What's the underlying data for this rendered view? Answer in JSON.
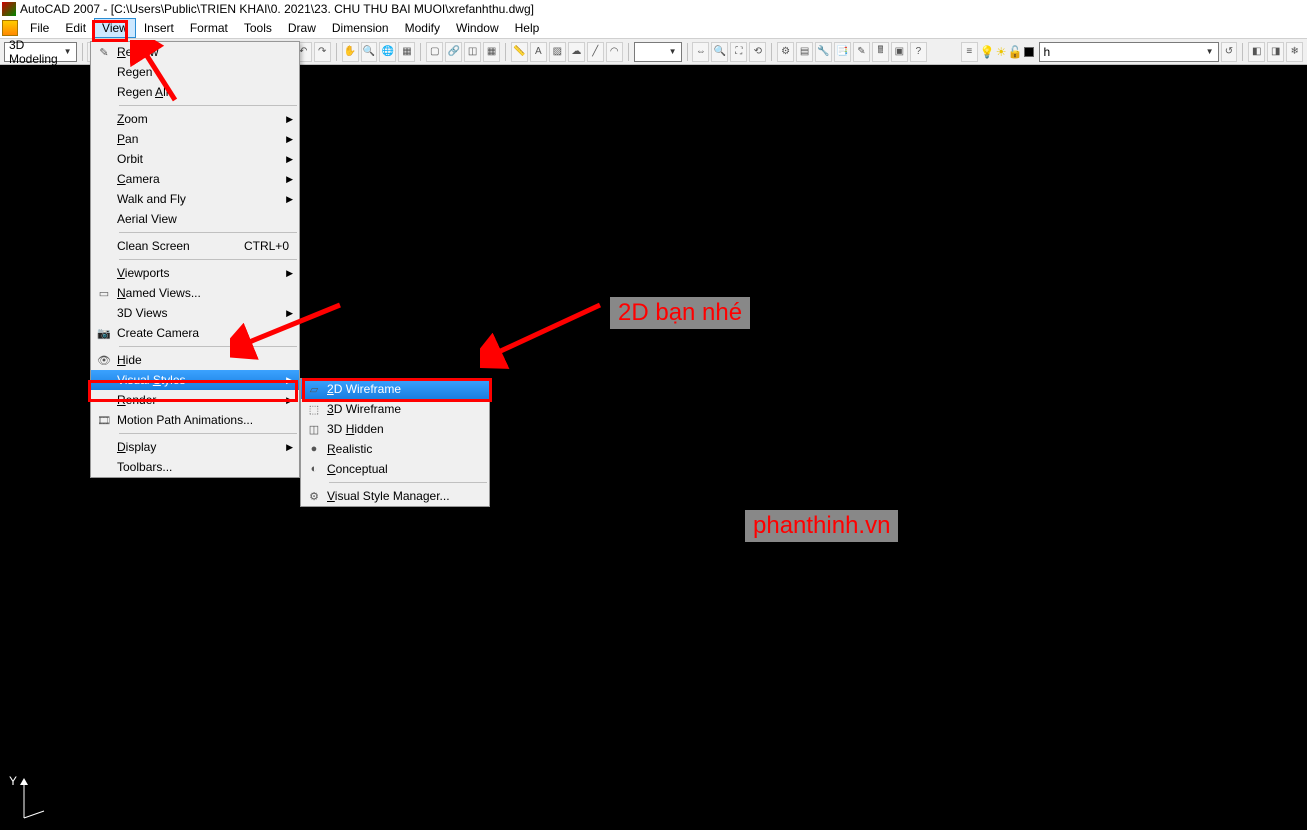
{
  "titlebar": {
    "text": "AutoCAD 2007 - [C:\\Users\\Public\\TRIEN KHAI\\0. 2021\\23. CHU THU BAI MUOI\\xrefanhthu.dwg]"
  },
  "menubar": {
    "items": [
      "File",
      "Edit",
      "View",
      "Insert",
      "Format",
      "Tools",
      "Draw",
      "Dimension",
      "Modify",
      "Window",
      "Help"
    ],
    "active_index": 2
  },
  "toolbar": {
    "workspace_combo": "3D Modeling",
    "layer_combo": "h"
  },
  "view_menu": {
    "groups": [
      [
        {
          "label": "Redraw",
          "u": 0,
          "icon": "pencil",
          "arrow": false
        },
        {
          "label": "Regen",
          "u": 2,
          "arrow": false
        },
        {
          "label": "Regen All",
          "u": 6,
          "arrow": false
        }
      ],
      [
        {
          "label": "Zoom",
          "u": 0,
          "arrow": true
        },
        {
          "label": "Pan",
          "u": 0,
          "arrow": true
        },
        {
          "label": "Orbit",
          "u": -1,
          "arrow": true
        },
        {
          "label": "Camera",
          "u": 0,
          "arrow": true
        },
        {
          "label": "Walk and Fly",
          "u": -1,
          "arrow": true
        },
        {
          "label": "Aerial View",
          "u": -1,
          "arrow": false
        }
      ],
      [
        {
          "label": "Clean Screen",
          "u": -1,
          "accel": "CTRL+0",
          "arrow": false
        }
      ],
      [
        {
          "label": "Viewports",
          "u": 0,
          "arrow": true
        },
        {
          "label": "Named Views...",
          "u": 0,
          "icon": "views",
          "arrow": false
        },
        {
          "label": "3D Views",
          "u": -1,
          "arrow": true
        },
        {
          "label": "Create Camera",
          "u": -1,
          "icon": "camera",
          "arrow": false
        }
      ],
      [
        {
          "label": "Hide",
          "u": 0,
          "icon": "hide",
          "arrow": false
        },
        {
          "label": "Visual Styles",
          "u": 7,
          "arrow": true,
          "highlight": true
        },
        {
          "label": "Render",
          "u": 0,
          "arrow": true
        },
        {
          "label": "Motion Path Animations...",
          "u": -1,
          "icon": "motion",
          "arrow": false
        }
      ],
      [
        {
          "label": "Display",
          "u": 0,
          "arrow": true
        },
        {
          "label": "Toolbars...",
          "u": -1,
          "arrow": false
        }
      ]
    ]
  },
  "visual_styles_submenu": {
    "groups": [
      [
        {
          "label": "2D Wireframe",
          "u": 0,
          "icon": "wire2d",
          "highlight": true
        },
        {
          "label": "3D Wireframe",
          "u": 0,
          "icon": "wire3d"
        },
        {
          "label": "3D Hidden",
          "u": 3,
          "icon": "hidden"
        },
        {
          "label": "Realistic",
          "u": 0,
          "icon": "realistic"
        },
        {
          "label": "Conceptual",
          "u": 0,
          "icon": "conceptual"
        }
      ],
      [
        {
          "label": "Visual Style Manager...",
          "u": 0,
          "icon": "manager"
        }
      ]
    ]
  },
  "annotations": {
    "top": "2D bạn nhé",
    "bottom": "phanthinh.vn"
  }
}
